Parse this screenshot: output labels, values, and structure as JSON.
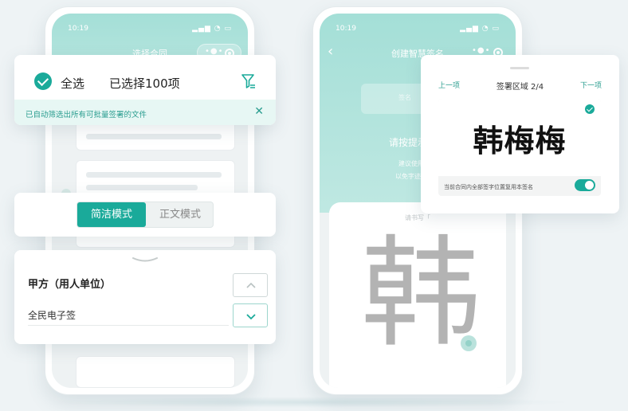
{
  "colors": {
    "accent": "#1aaa9a",
    "accent_light": "#e7f7f4",
    "header_teal": "#a4dfd7",
    "background": "#eef3f5"
  },
  "left_phone": {
    "status_time": "10:19",
    "nav_title": "选择合同"
  },
  "right_phone": {
    "status_time": "10:19",
    "nav_title": "创建智慧签名",
    "prompt_title": "请按提示书写",
    "prompt_line1": "建议使用楷书",
    "prompt_line2": "以免字迹潦草无",
    "pad_hint": "请书写「",
    "guide_char": "韩"
  },
  "select_card": {
    "select_all_label": "全选",
    "selected_count_label": "已选择100项",
    "notice_text": "已自动筛选出所有可批量签署的文件",
    "close_icon": "close-icon",
    "filter_icon": "filter-icon"
  },
  "mode_card": {
    "modes": [
      "简洁模式",
      "正文模式"
    ],
    "active_mode": "简洁模式"
  },
  "party_card": {
    "label": "甲方（用人单位）",
    "value": "全民电子签"
  },
  "signature_card": {
    "prev_label": "上一项",
    "title": "签署区域 2/4",
    "next_label": "下一项",
    "signature_text": "韩梅梅",
    "reuse_label": "当前合同内全部签字位置复用本签名",
    "reuse_enabled": true
  }
}
